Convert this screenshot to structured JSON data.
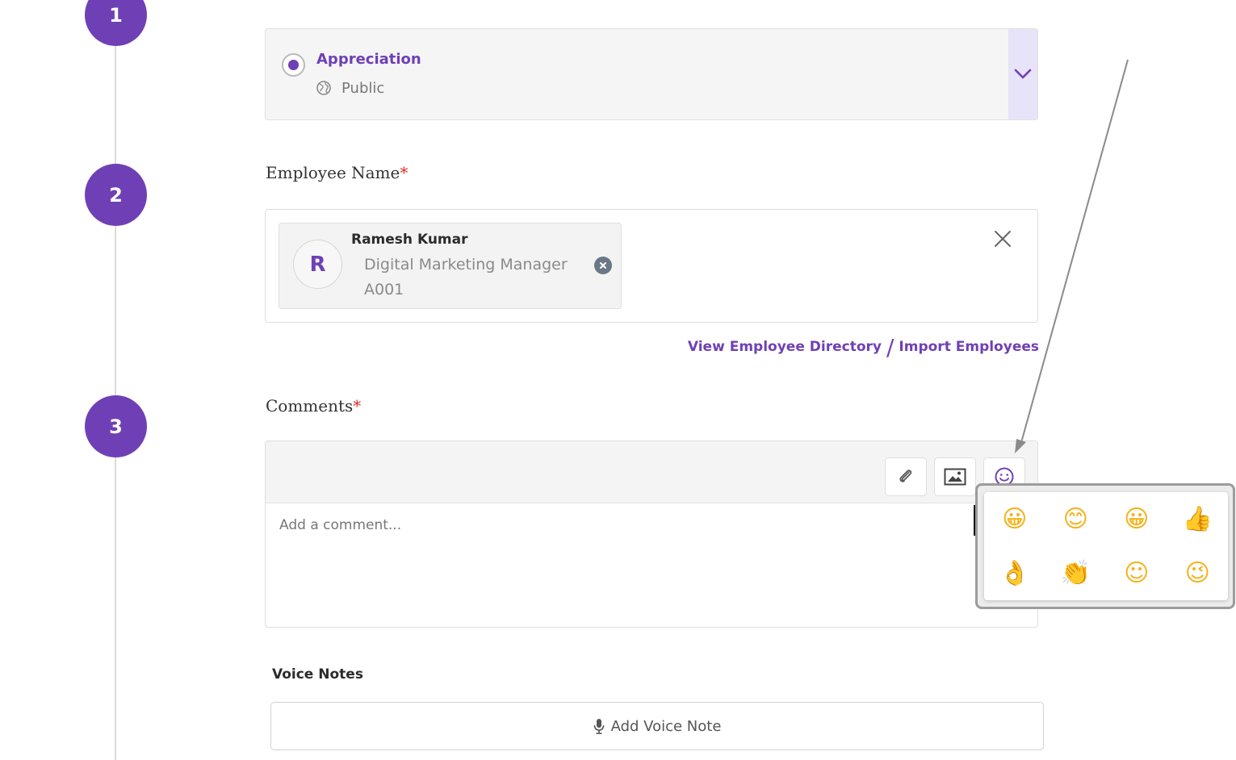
{
  "steps": [
    "1",
    "2",
    "3"
  ],
  "category": {
    "label": "Appreciation",
    "visibility": "Public",
    "selected": true
  },
  "employee": {
    "label": "Employee Name",
    "required_mark": "*",
    "avatar_initial": "R",
    "name": "Ramesh Kumar",
    "title": "Digital Marketing Manager",
    "id": "A001"
  },
  "links": {
    "directory": "View Employee Directory",
    "separator": "/",
    "import": "Import Employees"
  },
  "comments": {
    "label": "Comments",
    "required_mark": "*",
    "placeholder": "Add a comment...",
    "toolbar": [
      "paperclip-icon",
      "image-icon",
      "smiley-icon"
    ]
  },
  "emoji_picker": {
    "emojis": [
      "😀",
      "😊",
      "😀",
      "👍",
      "👌",
      "👏",
      "☺",
      "😉"
    ]
  },
  "voice": {
    "label": "Voice Notes",
    "button": "Add Voice Note"
  },
  "colors": {
    "accent": "#6f40b5",
    "required": "#e02b2b",
    "chevron_bg": "#e7e3f8"
  }
}
